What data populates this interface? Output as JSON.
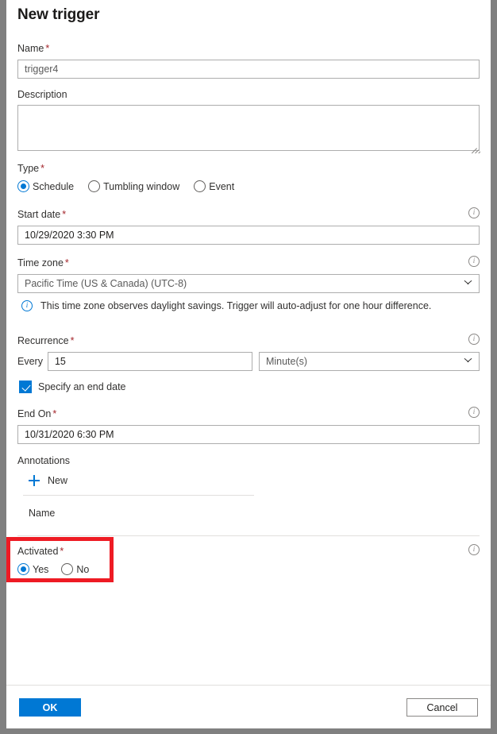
{
  "window": {
    "title": "New trigger"
  },
  "fields": {
    "name": {
      "label": "Name",
      "required": "*",
      "value": "trigger4"
    },
    "description": {
      "label": "Description",
      "value": ""
    },
    "type": {
      "label": "Type",
      "required": "*",
      "options": [
        {
          "label": "Schedule",
          "selected": true
        },
        {
          "label": "Tumbling window",
          "selected": false
        },
        {
          "label": "Event",
          "selected": false
        }
      ]
    },
    "start_date": {
      "label": "Start date",
      "required": "*",
      "value": "10/29/2020 3:30 PM",
      "info_icon": "info-icon"
    },
    "time_zone": {
      "label": "Time zone",
      "required": "*",
      "value": "Pacific Time (US & Canada) (UTC-8)",
      "info_icon": "info-icon",
      "chevron_icon": "chevron-down-icon",
      "message": "This time zone observes daylight savings. Trigger will auto-adjust for one hour difference.",
      "message_icon": "info-icon"
    },
    "recurrence": {
      "label": "Recurrence",
      "required": "*",
      "every_label": "Every",
      "interval_value": "15",
      "unit_value": "Minute(s)",
      "info_icon": "info-icon",
      "chevron_icon": "chevron-down-icon"
    },
    "specify_end_date": {
      "label": "Specify an end date",
      "checked": true,
      "check_icon": "checkmark-icon"
    },
    "end_on": {
      "label": "End On",
      "required": "*",
      "value": "10/31/2020 6:30 PM",
      "info_icon": "info-icon"
    },
    "annotations": {
      "label": "Annotations",
      "new_label": "New",
      "new_icon": "plus-icon",
      "column_name": "Name"
    },
    "activated": {
      "label": "Activated",
      "required": "*",
      "info_icon": "info-icon",
      "options": [
        {
          "label": "Yes",
          "selected": true
        },
        {
          "label": "No",
          "selected": false
        }
      ]
    }
  },
  "footer": {
    "ok_label": "OK",
    "cancel_label": "Cancel"
  },
  "highlight": {
    "color": "#ee1b24"
  }
}
